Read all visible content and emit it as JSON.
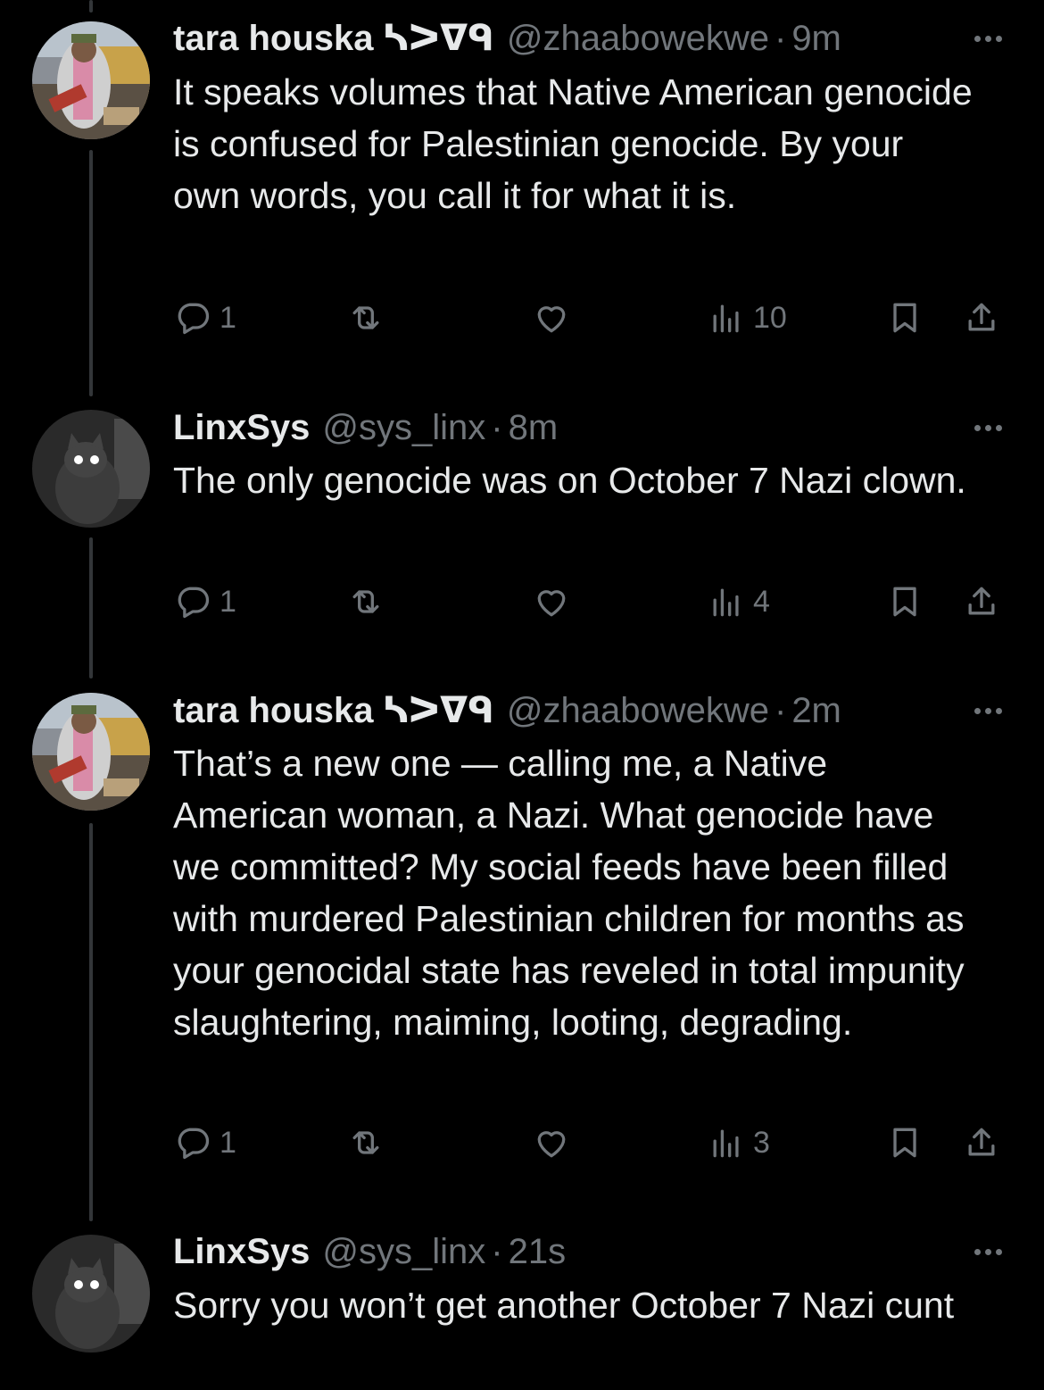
{
  "tweets": [
    {
      "name": "tara houska",
      "name_glyph": "ᓴᐳᐁᑫ",
      "handle": "@zhaabowekwe",
      "time": "9m",
      "text": "It speaks volumes that Native American genocide is confused for Palestinian genocide. By your own words, you call it for what it is.",
      "replies": "1",
      "views": "10",
      "avatar": "person-photo"
    },
    {
      "name": "LinxSys",
      "name_glyph": "",
      "handle": "@sys_linx",
      "time": "8m",
      "text": "The only genocide was on October 7 Nazi clown.",
      "replies": "1",
      "views": "4",
      "avatar": "cat-photo"
    },
    {
      "name": "tara houska",
      "name_glyph": "ᓴᐳᐁᑫ",
      "handle": "@zhaabowekwe",
      "time": "2m",
      "text": "That’s a new one — calling me, a Native American woman, a Nazi. What genocide have we committed? My social feeds have been filled with murdered Palestinian children for months as your genocidal state has reveled in total impunity slaughtering, maiming, looting, degrading.",
      "replies": "1",
      "views": "3",
      "avatar": "person-photo"
    },
    {
      "name": "LinxSys",
      "name_glyph": "",
      "handle": "@sys_linx",
      "time": "21s",
      "text": "Sorry you won’t get another October 7 Nazi cunt",
      "avatar": "cat-photo"
    }
  ],
  "colors": {
    "background": "#000000",
    "text": "#e7e9ea",
    "secondary": "#71767b",
    "thread_line": "#333639"
  }
}
